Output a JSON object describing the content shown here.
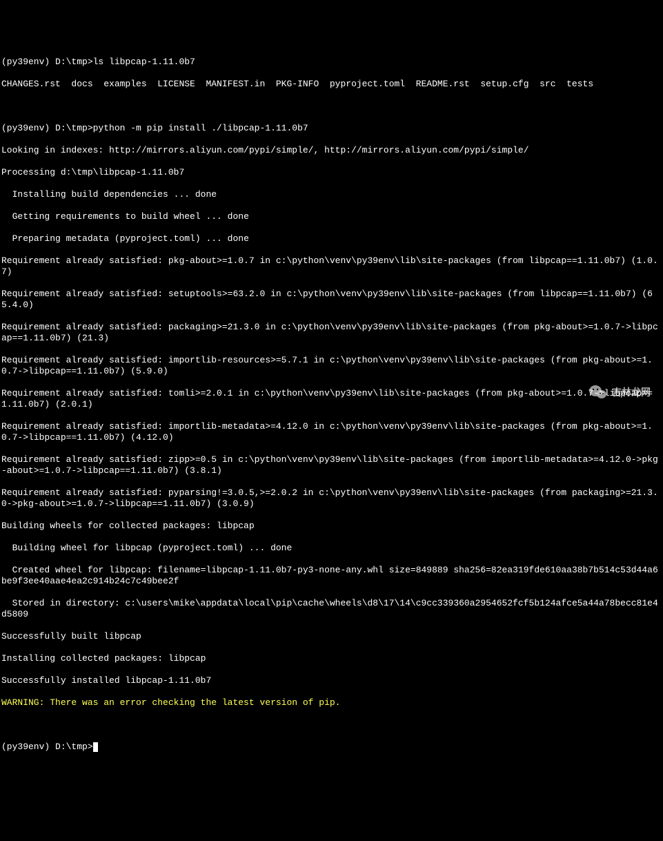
{
  "prompt": "(py39env) D:\\tmp>",
  "cmd_ls": "ls libpcap-1.11.0b7",
  "ls_output": "CHANGES.rst  docs  examples  LICENSE  MANIFEST.in  PKG-INFO  pyproject.toml  README.rst  setup.cfg  src  tests",
  "cmd_pip": "python -m pip install ./libpcap-1.11.0b7",
  "lines": [
    "Looking in indexes: http://mirrors.aliyun.com/pypi/simple/, http://mirrors.aliyun.com/pypi/simple/",
    "Processing d:\\tmp\\libpcap-1.11.0b7",
    "  Installing build dependencies ... done",
    "  Getting requirements to build wheel ... done",
    "  Preparing metadata (pyproject.toml) ... done",
    "Requirement already satisfied: pkg-about>=1.0.7 in c:\\python\\venv\\py39env\\lib\\site-packages (from libpcap==1.11.0b7) (1.0.7)",
    "Requirement already satisfied: setuptools>=63.2.0 in c:\\python\\venv\\py39env\\lib\\site-packages (from libpcap==1.11.0b7) (65.4.0)",
    "Requirement already satisfied: packaging>=21.3.0 in c:\\python\\venv\\py39env\\lib\\site-packages (from pkg-about>=1.0.7->libpcap==1.11.0b7) (21.3)",
    "Requirement already satisfied: importlib-resources>=5.7.1 in c:\\python\\venv\\py39env\\lib\\site-packages (from pkg-about>=1.0.7->libpcap==1.11.0b7) (5.9.0)",
    "Requirement already satisfied: tomli>=2.0.1 in c:\\python\\venv\\py39env\\lib\\site-packages (from pkg-about>=1.0.7->libpcap==1.11.0b7) (2.0.1)",
    "Requirement already satisfied: importlib-metadata>=4.12.0 in c:\\python\\venv\\py39env\\lib\\site-packages (from pkg-about>=1.0.7->libpcap==1.11.0b7) (4.12.0)",
    "Requirement already satisfied: zipp>=0.5 in c:\\python\\venv\\py39env\\lib\\site-packages (from importlib-metadata>=4.12.0->pkg-about>=1.0.7->libpcap==1.11.0b7) (3.8.1)",
    "Requirement already satisfied: pyparsing!=3.0.5,>=2.0.2 in c:\\python\\venv\\py39env\\lib\\site-packages (from packaging>=21.3.0->pkg-about>=1.0.7->libpcap==1.11.0b7) (3.0.9)",
    "Building wheels for collected packages: libpcap",
    "  Building wheel for libpcap (pyproject.toml) ... done",
    "  Created wheel for libpcap: filename=libpcap-1.11.0b7-py3-none-any.whl size=849889 sha256=82ea319fde610aa38b7b514c53d44a6be9f3ee40aae4ea2c914b24c7c49bee2f",
    "  Stored in directory: c:\\users\\mike\\appdata\\local\\pip\\cache\\wheels\\d8\\17\\14\\c9cc339360a2954652fcf5b124afce5a44a78becc81e4d5809",
    "Successfully built libpcap",
    "Installing collected packages: libpcap",
    "Successfully installed libpcap-1.11.0b7"
  ],
  "warning": "WARNING: There was an error checking the latest version of pip.",
  "watermark": "吉林龙网"
}
